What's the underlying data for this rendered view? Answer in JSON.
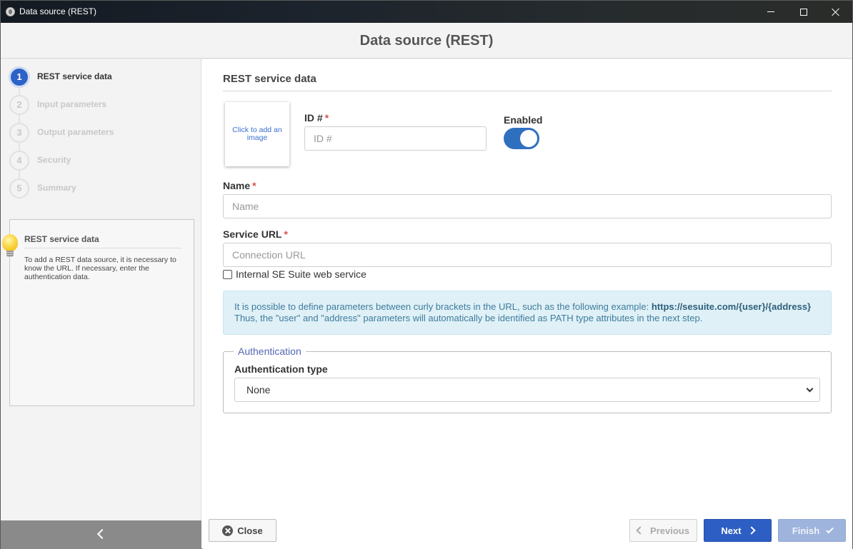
{
  "window": {
    "title": "Data source (REST)"
  },
  "header": {
    "title": "Data source (REST)"
  },
  "steps": [
    {
      "number": "1",
      "label": "REST service data",
      "active": true
    },
    {
      "number": "2",
      "label": "Input parameters",
      "active": false
    },
    {
      "number": "3",
      "label": "Output parameters",
      "active": false
    },
    {
      "number": "4",
      "label": "Security",
      "active": false
    },
    {
      "number": "5",
      "label": "Summary",
      "active": false
    }
  ],
  "help": {
    "title": "REST service data",
    "text": "To add a REST data source, it is necessary to know the URL. If necessary, enter the authentication data.",
    "icon": "lightbulb-icon"
  },
  "main": {
    "section_title": "REST service data",
    "image_placeholder": "Click to add an image",
    "id": {
      "label": "ID #",
      "required_mark": "*",
      "placeholder": "ID #",
      "value": ""
    },
    "enabled": {
      "label": "Enabled",
      "value": true
    },
    "name": {
      "label": "Name",
      "required_mark": "*",
      "placeholder": "Name",
      "value": ""
    },
    "service_url": {
      "label": "Service URL",
      "required_mark": "*",
      "placeholder": "Connection URL",
      "value": ""
    },
    "internal_checkbox": {
      "label": "Internal SE Suite web service",
      "checked": false
    },
    "info": {
      "line1_prefix": "It is possible to define parameters between curly brackets in the URL, such as the following example: ",
      "line1_example": "https://sesuite.com/{user}/{address}",
      "line2": "Thus, the \"user\" and \"address\" parameters will automatically be identified as PATH type attributes in the next step."
    },
    "authentication": {
      "legend": "Authentication",
      "type_label": "Authentication type",
      "type_value": "None"
    }
  },
  "footer": {
    "close_label": "Close",
    "previous_label": "Previous",
    "next_label": "Next",
    "finish_label": "Finish"
  },
  "colors": {
    "accent": "#2d5ec4",
    "toggle_on": "#2f6fbf",
    "info_bg": "#dff0f7",
    "required": "#d9534f"
  }
}
